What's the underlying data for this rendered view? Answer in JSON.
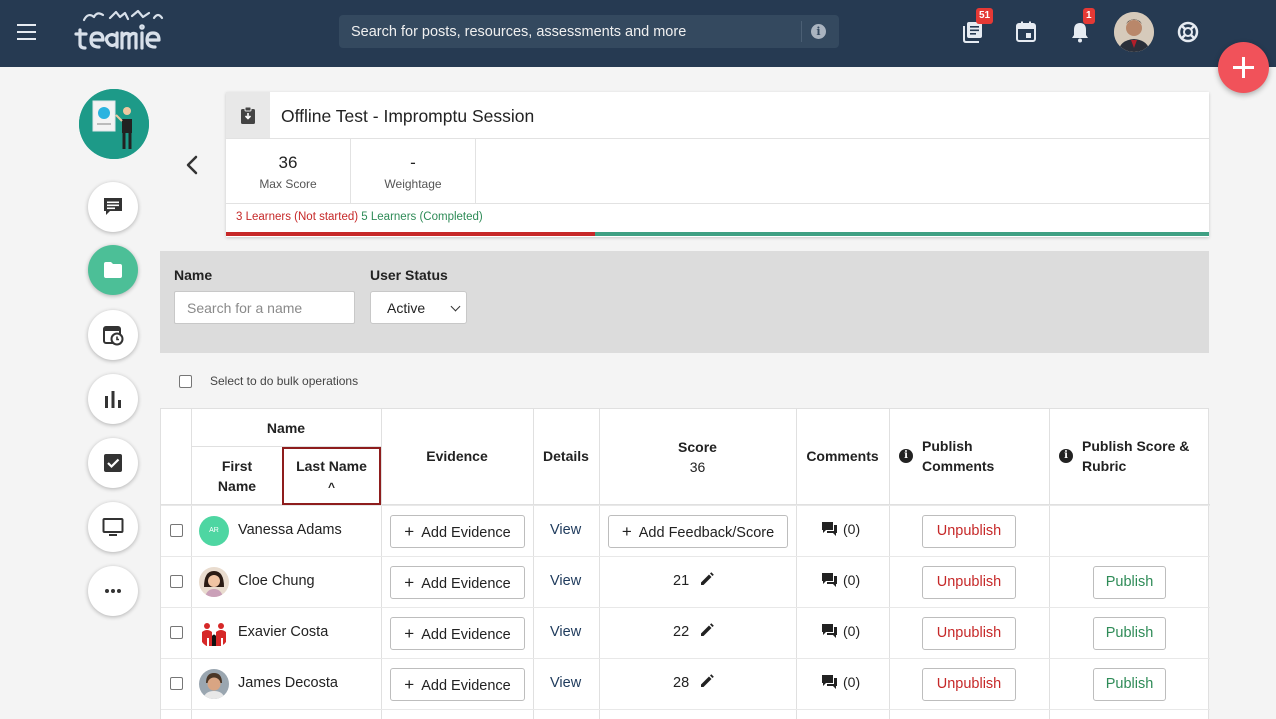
{
  "header": {
    "search_placeholder": "Search for posts, resources, assessments and more",
    "icons": [
      "menu-icon",
      "library-icon",
      "calendar-icon",
      "bell-icon",
      "help-icon"
    ],
    "library_badge": "51",
    "notification_badge": "1"
  },
  "colors": {
    "topbar": "#263a52",
    "accent_red": "#c62828",
    "accent_green": "#2e8b57",
    "fab": "#f1525a",
    "rail_active": "#4cbf97"
  },
  "assessment": {
    "title": "Offline Test - Impromptu Session",
    "max_score_value": "36",
    "max_score_label": "Max Score",
    "weightage_value": "-",
    "weightage_label": "Weightage",
    "not_started": "3 Learners (Not started)",
    "completed": "5 Learners (Completed)",
    "not_started_count": 3,
    "completed_count": 5
  },
  "filters": {
    "name_label": "Name",
    "name_placeholder": "Search for a name",
    "status_label": "User Status",
    "status_value": "Active"
  },
  "bulk": {
    "label": "Select to do bulk operations"
  },
  "table": {
    "headers": {
      "name": "Name",
      "first_name_line1": "First",
      "first_name_line2": "Name",
      "last_name": "Last Name",
      "sort_indicator": "^",
      "evidence": "Evidence",
      "details": "Details",
      "score": "Score",
      "score_max": "36",
      "comments": "Comments",
      "publish_comments_line1": "Publish",
      "publish_comments_line2": "Comments",
      "publish_rubric_line1": "Publish Score &",
      "publish_rubric_line2": "Rubric"
    },
    "rows": [
      {
        "name": "Vanessa Adams",
        "initials": "AR",
        "evidence": "Add Evidence",
        "details": "View",
        "feedback": "Add Feedback/Score",
        "comments": "(0)",
        "publish_comments": "Unpublish"
      },
      {
        "name": "Cloe Chung",
        "evidence": "Add Evidence",
        "details": "View",
        "score": "21",
        "comments": "(0)",
        "publish_comments": "Unpublish",
        "publish_rubric": "Publish"
      },
      {
        "name": "Exavier Costa",
        "evidence": "Add Evidence",
        "details": "View",
        "score": "22",
        "comments": "(0)",
        "publish_comments": "Unpublish",
        "publish_rubric": "Publish"
      },
      {
        "name": "James Decosta",
        "evidence": "Add Evidence",
        "details": "View",
        "score": "28",
        "comments": "(0)",
        "publish_comments": "Unpublish",
        "publish_rubric": "Publish"
      }
    ]
  }
}
